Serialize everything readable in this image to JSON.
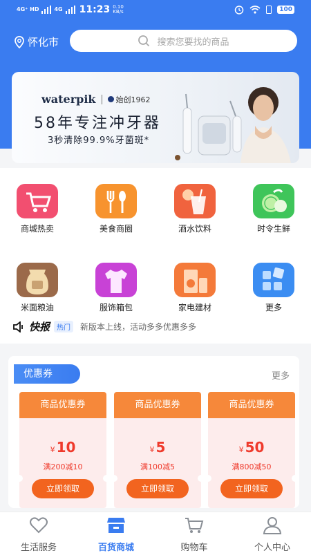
{
  "status_bar": {
    "signal_1": "4G⁺ HD",
    "signal_2": "4G",
    "time": "11:23",
    "net_speed_value": "0.10",
    "net_speed_unit": "KB/s",
    "battery": "100"
  },
  "header": {
    "city": "怀化市",
    "search_placeholder": "搜索您要找的商品"
  },
  "banner": {
    "brand": "waterpik",
    "brand_sub": "始创1962",
    "title": "58年专注冲牙器",
    "subtitle": "3秒清除99.9%牙菌斑*"
  },
  "categories": [
    {
      "label": "商城热卖",
      "color": "#f24f70"
    },
    {
      "label": "美食商圈",
      "color": "#f7932e"
    },
    {
      "label": "酒水饮料",
      "color": "#f0633e"
    },
    {
      "label": "时令生鲜",
      "color": "#3fc55a"
    },
    {
      "label": "米面粮油",
      "color": "#9b6a4a"
    },
    {
      "label": "服饰箱包",
      "color": "#c842d6"
    },
    {
      "label": "家电建材",
      "color": "#f47a3a"
    },
    {
      "label": "更多",
      "color": "#3b8df2"
    }
  ],
  "news": {
    "title": "快报",
    "tag": "热门",
    "text": "新版本上线，活动多多优惠多多"
  },
  "coupons": {
    "heading": "优惠券",
    "more": "更多",
    "items": [
      {
        "type": "商品优惠券",
        "currency": "¥",
        "amount": "10",
        "condition": "满200减10",
        "button": "立即领取"
      },
      {
        "type": "商品优惠券",
        "currency": "¥",
        "amount": "5",
        "condition": "满100减5",
        "button": "立即领取"
      },
      {
        "type": "商品优惠券",
        "currency": "¥",
        "amount": "50",
        "condition": "满800减50",
        "button": "立即领取"
      }
    ]
  },
  "tabbar": {
    "tabs": [
      {
        "label": "生活服务"
      },
      {
        "label": "百货商城"
      },
      {
        "label": "购物车"
      },
      {
        "label": "个人中心"
      }
    ],
    "active_color": "#3a7cf0"
  }
}
